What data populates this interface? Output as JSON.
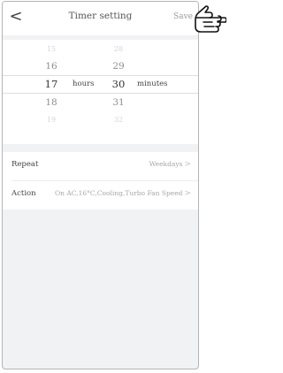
{
  "header": {
    "back_glyph": "<",
    "title": "Timer setting",
    "save_label": "Save"
  },
  "picker": {
    "hours": {
      "values": [
        "15",
        "16",
        "17",
        "18",
        "19"
      ],
      "selected": "17",
      "unit": "hours"
    },
    "minutes": {
      "values": [
        "28",
        "29",
        "30",
        "31",
        "32"
      ],
      "selected": "30",
      "unit": "minutes"
    }
  },
  "settings": [
    {
      "label": "Repeat",
      "value": "Weekdays"
    },
    {
      "label": "Action",
      "value": "On AC,16°C,Cooling,Turbo Fan Speed"
    }
  ],
  "icons": {
    "back": "chevron-left-icon",
    "row_arrow": "chevron-right-icon",
    "pointer": "pointing-hand-icon"
  }
}
